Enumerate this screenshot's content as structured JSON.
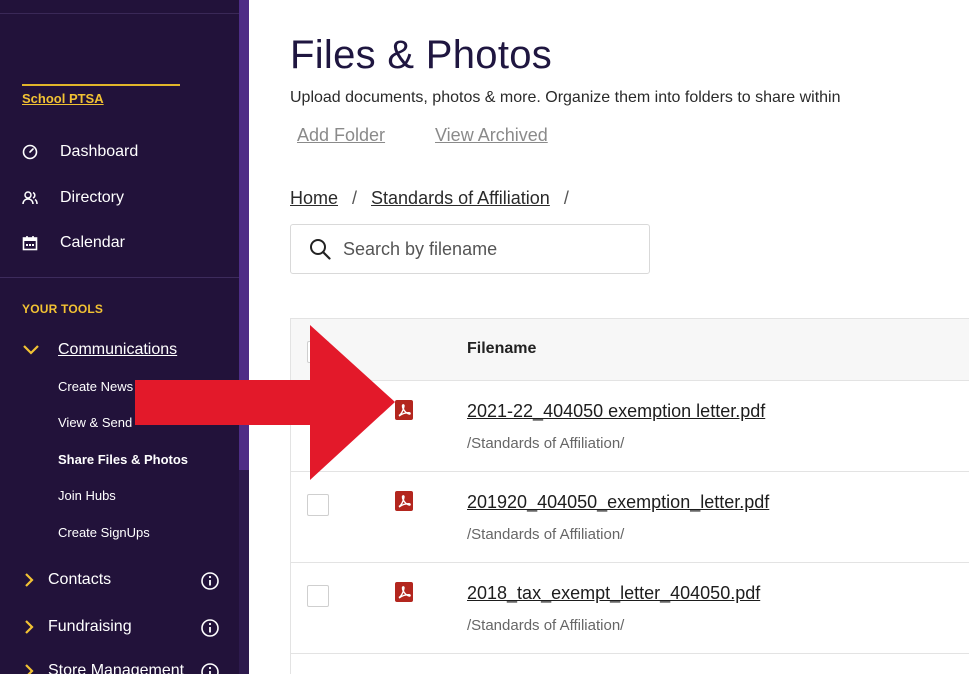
{
  "colors": {
    "sidebar_bg": "#22123a",
    "accent_yellow": "#f2c233",
    "sidebar_accent": "#4e2d86",
    "pdf_red": "#b3261e",
    "annotation_red": "#e3192a"
  },
  "sidebar": {
    "org_name": "School PTSA",
    "nav": [
      {
        "label": "Dashboard",
        "icon": "dashboard-gauge-icon"
      },
      {
        "label": "Directory",
        "icon": "people-icon"
      },
      {
        "label": "Calendar",
        "icon": "calendar-icon"
      }
    ],
    "section_label": "YOUR TOOLS",
    "communications": {
      "label": "Communications",
      "icon": "chevron-down-icon",
      "sub_items": [
        {
          "label": "Create News"
        },
        {
          "label": "View & Send"
        },
        {
          "label": "Share Files & Photos",
          "active": true
        },
        {
          "label": "Join Hubs"
        },
        {
          "label": "Create SignUps"
        }
      ]
    },
    "groups": [
      {
        "label": "Contacts",
        "icon": "chevron-right-icon",
        "info_icon": "info-icon"
      },
      {
        "label": "Fundraising",
        "icon": "chevron-right-icon",
        "info_icon": "info-icon"
      },
      {
        "label": "Store Management",
        "icon": "chevron-right-icon",
        "info_icon": "info-icon"
      }
    ]
  },
  "main": {
    "title": "Files & Photos",
    "description": "Upload documents, photos & more. Organize them into folders to share within",
    "actions": {
      "add_folder": "Add Folder",
      "view_archived": "View Archived"
    },
    "breadcrumb": {
      "home": "Home",
      "folder": "Standards of Affiliation",
      "separator": "/"
    },
    "search": {
      "placeholder": "Search by filename",
      "icon": "search-icon"
    },
    "table": {
      "column_filename": "Filename",
      "rows": [
        {
          "filename": "2021-22_404050 exemption letter.pdf",
          "path": "/Standards of Affiliation/",
          "icon": "pdf-icon"
        },
        {
          "filename": "201920_404050_exemption_letter.pdf",
          "path": "/Standards of Affiliation/",
          "icon": "pdf-icon"
        },
        {
          "filename": "2018_tax_exempt_letter_404050.pdf",
          "path": "/Standards of Affiliation/",
          "icon": "pdf-icon"
        }
      ]
    }
  }
}
